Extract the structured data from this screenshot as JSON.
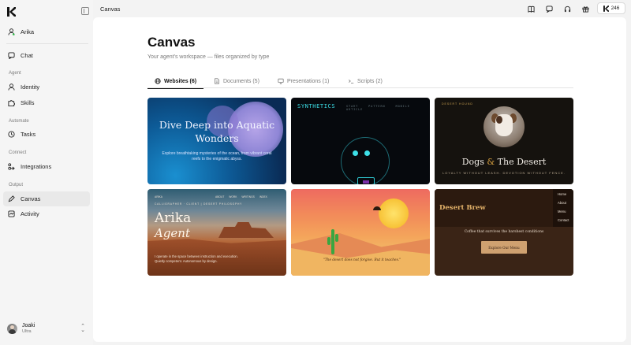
{
  "app": {
    "breadcrumb": "Canvas"
  },
  "sidebar": {
    "workspace": "Arika",
    "items": [
      {
        "label": "Chat",
        "icon": "chat-icon"
      },
      {
        "label": "Identity",
        "icon": "person-icon"
      },
      {
        "label": "Skills",
        "icon": "puzzle-icon"
      },
      {
        "label": "Tasks",
        "icon": "clock-icon"
      },
      {
        "label": "Integrations",
        "icon": "integrations-icon"
      },
      {
        "label": "Canvas",
        "icon": "pencil-icon",
        "active": true
      },
      {
        "label": "Activity",
        "icon": "activity-icon"
      }
    ],
    "sections": {
      "agent": "Agent",
      "automate": "Automate",
      "connect": "Connect",
      "output": "Output"
    },
    "profile": {
      "name": "Joaki",
      "plan": "Ultra"
    }
  },
  "topbar": {
    "icons": [
      "book-icon",
      "message-icon",
      "headset-icon",
      "gift-icon"
    ],
    "credits": "246"
  },
  "main": {
    "title": "Canvas",
    "subtitle": "Your agent's workspace — files organized by type",
    "tabs": [
      {
        "label": "Websites (6)",
        "icon": "globe-icon",
        "active": true
      },
      {
        "label": "Documents (5)",
        "icon": "document-icon"
      },
      {
        "label": "Presentations (1)",
        "icon": "monitor-icon"
      },
      {
        "label": "Scripts (2)",
        "icon": "terminal-icon"
      }
    ]
  },
  "cards": {
    "aquatic": {
      "heading": "Dive Deep into Aquatic Wonders",
      "text": "Explore breathtaking mysteries of the ocean, from vibrant coral reefs to the enigmatic abyss."
    },
    "synthetics": {
      "brand": "SYNTHETICS",
      "links": "START PATTERN MOBILE ARTICLE"
    },
    "dogs": {
      "top": "DESERT HOUND",
      "heading_a": "Dogs",
      "heading_amp": "&",
      "heading_b": "The Desert",
      "tagline": "LOYALTY WITHOUT LEASH. DEVOTION WITHOUT FENCE."
    },
    "arika": {
      "nav": "ARIKA",
      "links": "ABOUT WORK WRITINGS INDEX",
      "kicker": "CALLIGRAPHER · CLIENT | DESERT PHILOSOPHY",
      "heading_a": "Arika",
      "heading_b": "Agent",
      "text": "I operate in the space between instruction and execution. Quietly competent. Autonomous by design."
    },
    "desert": {
      "quote": "\"The desert does not forgive. But it teaches.\""
    },
    "brew": {
      "logo": "Desert Brew",
      "menu": [
        "Home",
        "About",
        "Menu",
        "Contact"
      ],
      "tagline": "Coffee that survives the harshest conditions",
      "button": "Explore Our Menu"
    }
  }
}
